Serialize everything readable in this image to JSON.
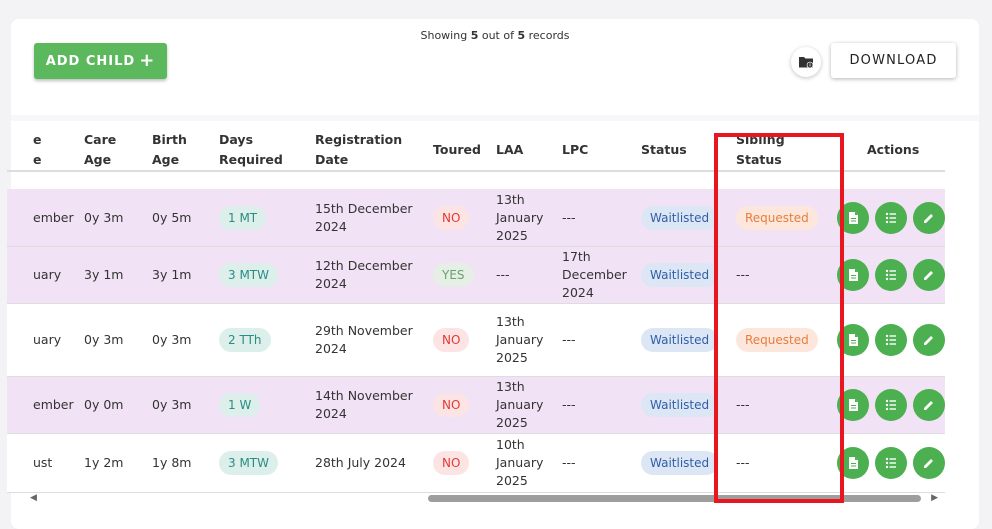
{
  "header": {
    "showing_prefix": "Showing",
    "showing_count": "5",
    "showing_mid": "out of",
    "showing_total": "5",
    "showing_suffix": "records",
    "add_child_label": "ADD CHILD",
    "add_child_icon": "plus-icon",
    "folder_icon": "folder-info-icon",
    "download_label": "DOWNLOAD"
  },
  "table": {
    "columns": {
      "name_partial_1": "e",
      "name_partial_2": "e",
      "care_age_1": "Care",
      "care_age_2": "Age",
      "birth_age_1": "Birth",
      "birth_age_2": "Age",
      "days_1": "Days",
      "days_2": "Required",
      "reg_1": "Registration",
      "reg_2": "Date",
      "toured": "Toured",
      "laa": "LAA",
      "lpc": "LPC",
      "status": "Status",
      "sibling_1": "Sibling",
      "sibling_2": "Status",
      "actions": "Actions"
    },
    "rows": [
      {
        "start": "ember",
        "care_age": "0y 3m",
        "birth_age": "0y 5m",
        "days": "1 MT",
        "reg_1": "15th December",
        "reg_2": "2024",
        "toured": "NO",
        "laa_1": "13th",
        "laa_2": "January",
        "laa_3": "2025",
        "lpc_1": "---",
        "lpc_2": "",
        "lpc_3": "",
        "status": "Waitlisted",
        "sibling": "Requested"
      },
      {
        "start": "uary",
        "care_age": "3y 1m",
        "birth_age": "3y 1m",
        "days": "3 MTW",
        "reg_1": "12th December",
        "reg_2": "2024",
        "toured": "YES",
        "laa_1": "---",
        "laa_2": "",
        "laa_3": "",
        "lpc_1": "17th",
        "lpc_2": "December",
        "lpc_3": "2024",
        "status": "Waitlisted",
        "sibling": "---"
      },
      {
        "start": "uary",
        "care_age": "0y 3m",
        "birth_age": "0y 3m",
        "days": "2 TTh",
        "reg_1": "29th November",
        "reg_2": "2024",
        "toured": "NO",
        "laa_1": "13th",
        "laa_2": "January",
        "laa_3": "2025",
        "lpc_1": "---",
        "lpc_2": "",
        "lpc_3": "",
        "status": "Waitlisted",
        "sibling": "Requested"
      },
      {
        "start": "ember",
        "care_age": "0y 0m",
        "birth_age": "0y 3m",
        "days": "1 W",
        "reg_1": "14th November",
        "reg_2": "2024",
        "toured": "NO",
        "laa_1": "13th",
        "laa_2": "January",
        "laa_3": "2025",
        "lpc_1": "---",
        "lpc_2": "",
        "lpc_3": "",
        "status": "Waitlisted",
        "sibling": "---"
      },
      {
        "start": "ust",
        "care_age": "1y 2m",
        "birth_age": "1y 8m",
        "days": "3 MTW",
        "reg_1": "28th July 2024",
        "reg_2": "",
        "toured": "NO",
        "laa_1": "10th",
        "laa_2": "January",
        "laa_3": "2025",
        "lpc_1": "---",
        "lpc_2": "",
        "lpc_3": "",
        "status": "Waitlisted",
        "sibling": "---"
      }
    ],
    "action_icons": [
      "document-icon",
      "list-icon",
      "edit-pencil-icon"
    ]
  },
  "colors": {
    "green": "#5cb85c",
    "highlight_red": "#e8171f",
    "pink_row": "#f1e2f5"
  }
}
